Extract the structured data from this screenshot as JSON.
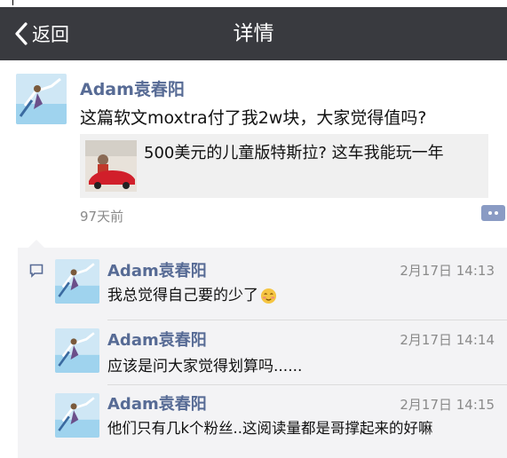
{
  "navbar": {
    "back_label": "返回",
    "title": "详情"
  },
  "post": {
    "author": "Adam袁春阳",
    "text": "这篇软文moxtra付了我2w块，大家觉得值吗?",
    "link": {
      "title": "500美元的儿童版特斯拉? 这车我能玩一年"
    },
    "time": "97天前"
  },
  "comments": [
    {
      "author": "Adam袁春阳",
      "time": "2月17日 14:13",
      "text": "我总觉得自己要的少了",
      "emoji": "blush-emoji"
    },
    {
      "author": "Adam袁春阳",
      "time": "2月17日 14:14",
      "text": "应该是问大家觉得划算吗......"
    },
    {
      "author": "Adam袁春阳",
      "time": "2月17日 14:15",
      "text": "他们只有几k个粉丝..这阅读量都是哥撑起来的好嘛"
    }
  ],
  "colors": {
    "navbar": "#393a3f",
    "name": "#576b95",
    "comment_bg": "#f3f3f5"
  },
  "icons": [
    "chevron-left-icon",
    "comment-icon",
    "more-icon"
  ]
}
